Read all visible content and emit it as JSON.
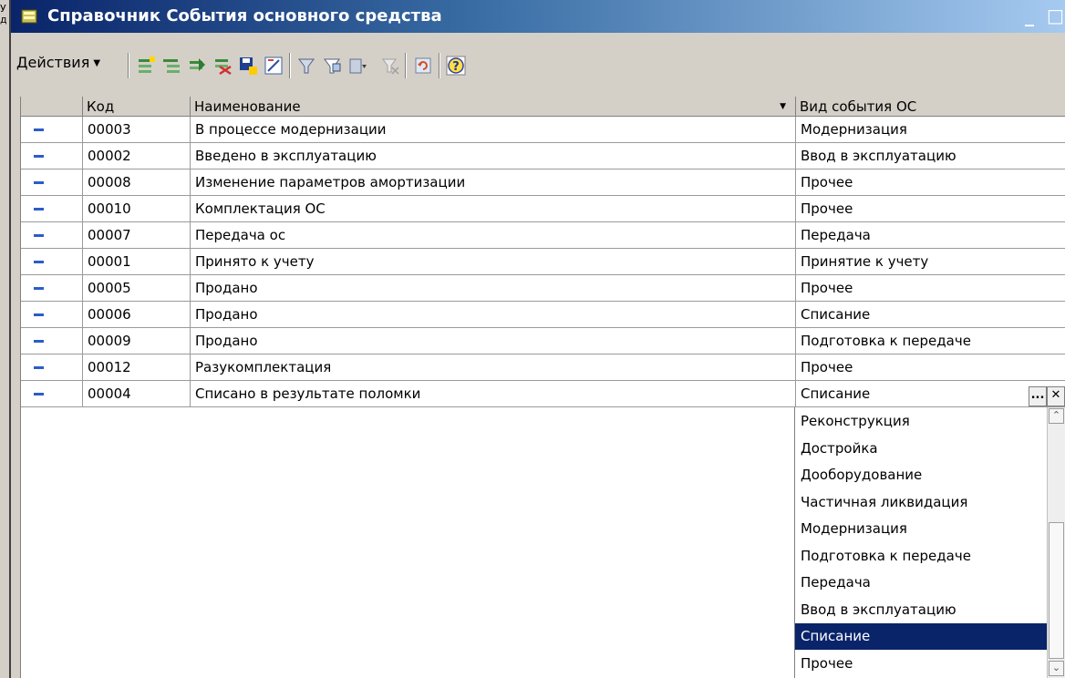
{
  "window": {
    "title": "Справочник События основного средства",
    "minimize": "_",
    "maximize": "□",
    "edge_chars": "У\nд"
  },
  "toolbar": {
    "actions_label": "Действия",
    "icons": [
      "add-icon",
      "add-group-icon",
      "copy-icon",
      "delete-icon",
      "save-icon",
      "edit-icon",
      "filter-icon",
      "filter-by-value-icon",
      "filter-history-icon",
      "clear-filter-icon",
      "refresh-icon",
      "help-icon"
    ]
  },
  "table": {
    "headers": {
      "code": "Код",
      "name": "Наименование",
      "event_type": "Вид события ОС"
    },
    "rows": [
      {
        "code": "00003",
        "name": "В процессе модернизации",
        "event_type": "Модернизация"
      },
      {
        "code": "00002",
        "name": "Введено в эксплуатацию",
        "event_type": "Ввод в эксплуатацию"
      },
      {
        "code": "00008",
        "name": "Изменение параметров амортизации",
        "event_type": "Прочее"
      },
      {
        "code": "00010",
        "name": "Комплектация ОС",
        "event_type": "Прочее"
      },
      {
        "code": "00007",
        "name": "Передача ос",
        "event_type": "Передача"
      },
      {
        "code": "00001",
        "name": "Принято к учету",
        "event_type": "Принятие к учету"
      },
      {
        "code": "00005",
        "name": "Продано",
        "event_type": "Прочее"
      },
      {
        "code": "00006",
        "name": "Продано",
        "event_type": "Списание"
      },
      {
        "code": "00009",
        "name": "Продано",
        "event_type": "Подготовка к передаче"
      },
      {
        "code": "00012",
        "name": "Разукомплектация",
        "event_type": "Прочее"
      },
      {
        "code": "00004",
        "name": "Списано в результате поломки",
        "event_type": "Списание"
      }
    ]
  },
  "edit_buttons": {
    "select": "...",
    "clear": "✕"
  },
  "dropdown": {
    "options": [
      "Реконструкция",
      "Дострой­ка",
      "Дооборудование",
      "Частичная ликвидация",
      "Модернизация",
      "Подготовка к передаче",
      "Передача",
      "Ввод в эксплуатацию",
      "Списание",
      "Прочее"
    ],
    "selected": "Списание",
    "scroll_up": "⌃",
    "scroll_down": "⌄"
  },
  "colors": {
    "title_start": "#0a246a",
    "title_end": "#a6caf0",
    "selection": "#0a246a",
    "row_marker": "#2c5cc8"
  }
}
